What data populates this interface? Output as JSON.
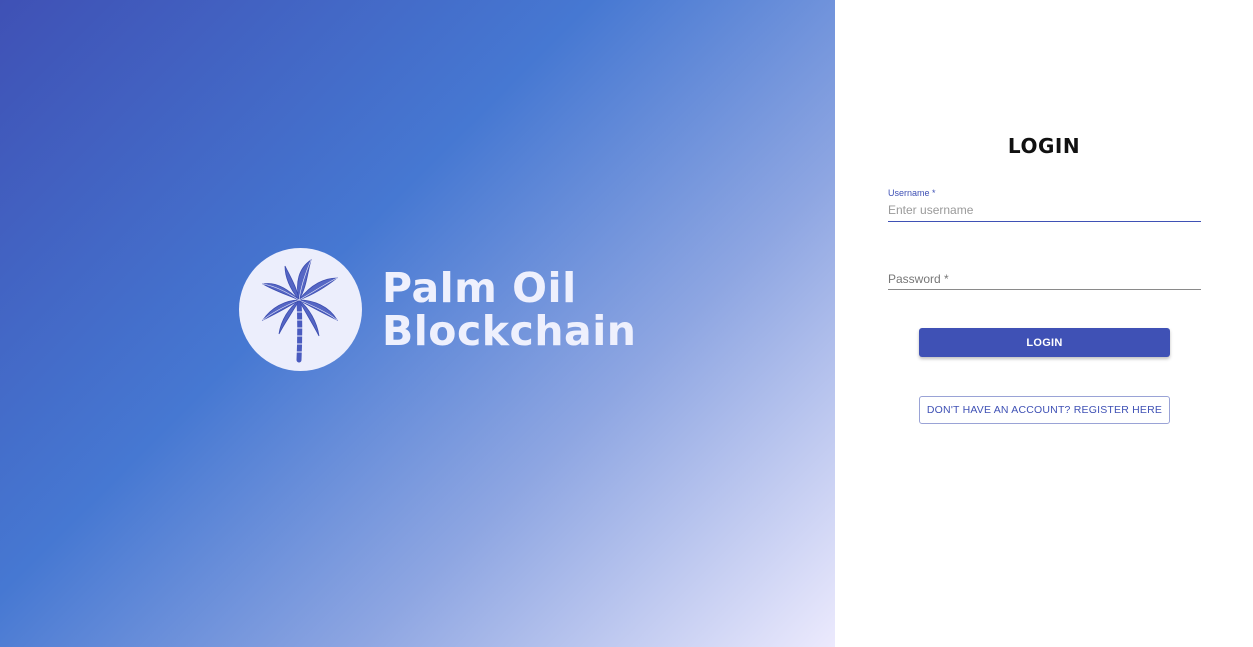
{
  "brand": {
    "line1": "Palm Oil",
    "line2": "Blockchain",
    "logo_icon": "palm-tree-icon",
    "logo_bg": "#eceefc",
    "text_color": "#eef0fd"
  },
  "theme": {
    "accent": "#3f51b5",
    "gradient_start": "#3f51b5",
    "gradient_mid": "#4678d2",
    "gradient_end": "#eceafd"
  },
  "login": {
    "title": "LOGIN",
    "username": {
      "label": "Username *",
      "placeholder": "Enter username",
      "value": ""
    },
    "password": {
      "placeholder": "Password *",
      "value": ""
    },
    "submit_label": "LOGIN",
    "register_label": "DON'T HAVE AN ACCOUNT? REGISTER HERE"
  }
}
